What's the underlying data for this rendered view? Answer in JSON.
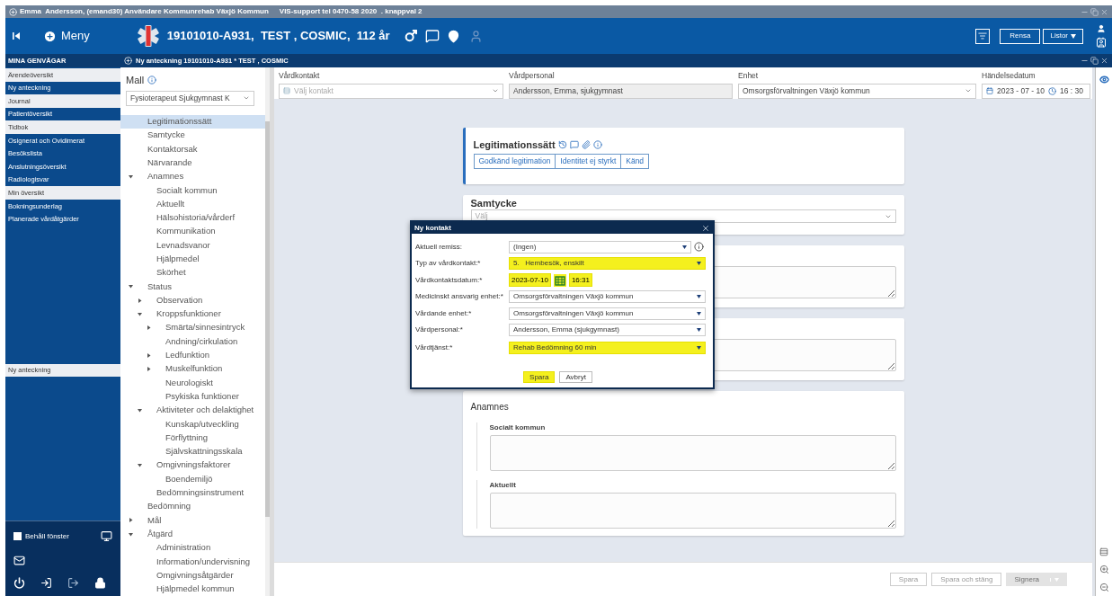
{
  "title_bar": {
    "user": "Emma  Andersson, (emand30) Användare Kommunrehab Växjö Kommun",
    "support": "VIS-support tel 0470-58 2020  . knappval 2"
  },
  "header": {
    "menu": "Meny",
    "patient": "19101010-A931,  TEST , COSMIC,  112 år",
    "buttons": [
      "Rensa",
      "Listor"
    ]
  },
  "shortcuts": {
    "title": "MINA GENVÄGAR",
    "items": [
      {
        "label": "Ärendeöversikt",
        "open": true
      },
      {
        "label": "Ny anteckning",
        "open": false
      },
      {
        "label": "Journal",
        "open": true
      },
      {
        "label": "Patientöversikt",
        "open": false
      },
      {
        "label": "Tidbok",
        "open": true
      },
      {
        "label": "Osignerat och Ovidimerat",
        "open": false
      },
      {
        "label": "Besökslista",
        "open": false
      },
      {
        "label": "Anslutningsöversikt",
        "open": false
      },
      {
        "label": "Radiologisvar",
        "open": false
      },
      {
        "label": "Min översikt",
        "open": true
      },
      {
        "label": "Bokningsunderlag",
        "open": false
      },
      {
        "label": "Planerade vårdåtgärder",
        "open": false
      }
    ],
    "bottom_items": [
      {
        "label": "Ny anteckning",
        "open": true
      }
    ],
    "keep_window": {
      "label": "Behåll fönster",
      "checked": false
    }
  },
  "note_bar": {
    "title": "Ny anteckning 19101010-A931 * TEST , COSMIC"
  },
  "template": {
    "label": "Mall",
    "value": "Fysioterapeut Sjukgymnast K",
    "tree": [
      {
        "label": "Legitimationssätt",
        "selected": true
      },
      {
        "label": "Samtycke",
        "selected": false
      },
      {
        "label": "Kontaktorsak",
        "selected": false
      },
      {
        "label": "Närvarande",
        "selected": false
      },
      {
        "label": "Anamnes",
        "selected": false,
        "expanded": true,
        "children": [
          {
            "label": "Socialt kommun",
            "selected": false
          },
          {
            "label": "Aktuellt",
            "selected": false
          },
          {
            "label": "Hälsohistoria/vårderf",
            "selected": false
          },
          {
            "label": "Kommunikation",
            "selected": false
          },
          {
            "label": "Levnadsvanor",
            "selected": false
          },
          {
            "label": "Hjälpmedel",
            "selected": false
          },
          {
            "label": "Skörhet",
            "selected": false
          }
        ]
      },
      {
        "label": "Status",
        "selected": false,
        "expanded": true,
        "children": [
          {
            "label": "Observation",
            "selected": false,
            "expanded": false
          },
          {
            "label": "Kroppsfunktioner",
            "selected": false,
            "expanded": true,
            "children": [
              {
                "label": "Smärta/sinnesintryck",
                "selected": false,
                "expanded": false
              },
              {
                "label": "Andning/cirkulation",
                "selected": false
              },
              {
                "label": "Ledfunktion",
                "selected": false,
                "expanded": false
              },
              {
                "label": "Muskelfunktion",
                "selected": false,
                "expanded": false
              },
              {
                "label": "Neurologiskt",
                "selected": false
              },
              {
                "label": "Psykiska funktioner",
                "selected": false
              }
            ]
          },
          {
            "label": "Aktiviteter och delaktighet",
            "selected": false,
            "expanded": true,
            "children": [
              {
                "label": "Kunskap/utveckling",
                "selected": false
              },
              {
                "label": "Förflyttning",
                "selected": false
              },
              {
                "label": "Självskattningsskala",
                "selected": false
              }
            ]
          },
          {
            "label": "Omgivningsfaktorer",
            "selected": false,
            "expanded": true,
            "children": [
              {
                "label": "Boendemiljö",
                "selected": false
              }
            ]
          },
          {
            "label": "Bedömningsinstrument",
            "selected": false
          }
        ]
      },
      {
        "label": "Bedömning",
        "selected": false
      },
      {
        "label": "Mål",
        "selected": false,
        "expanded": false
      },
      {
        "label": "Åtgärd",
        "selected": false,
        "expanded": true,
        "children": [
          {
            "label": "Administration",
            "selected": false
          },
          {
            "label": "Information/undervisning",
            "selected": false
          },
          {
            "label": "Omgivningsåtgärder",
            "selected": false
          },
          {
            "label": "Hjälpmedel kommun",
            "selected": false
          }
        ]
      }
    ]
  },
  "top_fields": [
    {
      "label": "Vårdkontakt",
      "kind": "select",
      "placeholder": "Välj kontakt"
    },
    {
      "label": "Vårdpersonal",
      "kind": "readonly",
      "value": "Andersson, Emma, sjukgymnast"
    },
    {
      "label": "Enhet",
      "kind": "select",
      "value": "Omsorgsförvaltningen Växjö kommun"
    },
    {
      "label": "Händelsedatum",
      "kind": "datetime",
      "date": "2023 - 07 - 10",
      "time": "16 : 30"
    }
  ],
  "cards": [
    {
      "kind": "choice",
      "title": "Legitimationssätt",
      "options": [
        {
          "label": "Godkänd legitimation",
          "selected": false
        },
        {
          "label": "Identitet ej styrkt",
          "selected": false
        },
        {
          "label": "Känd",
          "selected": false
        }
      ]
    },
    {
      "kind": "select",
      "title": "Samtycke",
      "placeholder": "Välj"
    },
    {
      "kind": "text"
    },
    {
      "kind": "text"
    },
    {
      "kind": "section",
      "title": "Anamnes",
      "fields": [
        {
          "label": "Socialt kommun"
        },
        {
          "label": "Aktuellt"
        }
      ]
    }
  ],
  "footer_buttons": [
    {
      "label": "Spara",
      "disabled": false
    },
    {
      "label": "Spara och stäng",
      "disabled": false
    },
    {
      "label": "Signera",
      "disabled": true
    }
  ],
  "dialog": {
    "title": "Ny kontakt",
    "rows": [
      {
        "label": "Aktuell remiss:",
        "kind": "select",
        "value": "(Ingen)",
        "highlighted": false,
        "info": true
      },
      {
        "label": "Typ av vårdkontakt:*",
        "kind": "select",
        "value": "5.   Hembesök, enskilt",
        "highlighted": true
      },
      {
        "label": "Vårdkontaktsdatum:*",
        "kind": "datetime",
        "date": "2023-07-10",
        "time": "16:31",
        "highlighted": true
      },
      {
        "label": "Medicinskt ansvarig enhet:*",
        "kind": "select",
        "value": "Omsorgsförvaltningen Växjö kommun",
        "highlighted": false
      },
      {
        "label": "Vårdande enhet:*",
        "kind": "select",
        "value": "Omsorgsförvaltningen Växjö kommun",
        "highlighted": false
      },
      {
        "label": "Vårdpersonal:*",
        "kind": "select",
        "value": "Andersson, Emma (sjukgymnast)",
        "highlighted": false
      },
      {
        "label": "Vårdtjänst:*",
        "kind": "select",
        "value": "Rehab Bedömning 60 min",
        "highlighted": true
      }
    ],
    "buttons": [
      {
        "label": "Spara",
        "highlighted": true
      },
      {
        "label": "Avbryt",
        "highlighted": false
      }
    ]
  }
}
